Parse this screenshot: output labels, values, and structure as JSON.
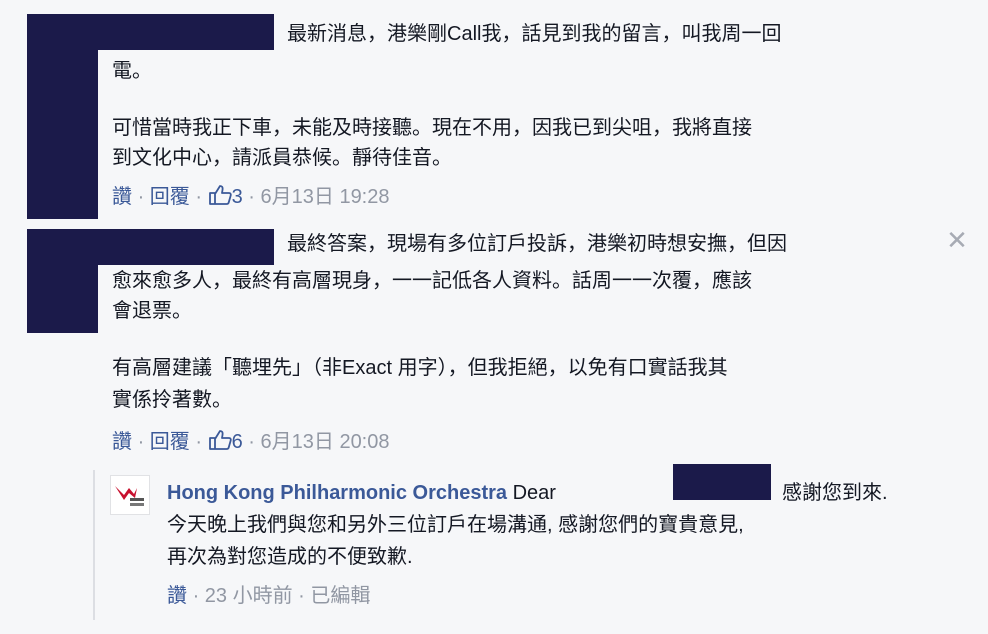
{
  "comments": [
    {
      "paragraphs": [
        "最新消息，港樂剛Call我，話見到我的留言，叫我周一回電。",
        "可惜當時我正下車，未能及時接聽。現在不用，因我已到尖咀，我將直接到文化中心，請派員恭候。靜待佳音。"
      ],
      "line1a": "最新消息，港樂剛Call我，話見到我的留言，叫我周一回",
      "line1b": "電。",
      "line2a": "可惜當時我正下車，未能及時接聽。現在不用，因我已到尖咀，我將直接",
      "line2b": "到文化中心，請派員恭候。靜待佳音。",
      "like_label": "讚",
      "sep": "·",
      "reply_label": "回覆",
      "like_count": "3",
      "timestamp": "6月13日 19:28"
    },
    {
      "line1a": "最終答案，現場有多位訂戶投訴，港樂初時想安撫，但因",
      "line1b": "愈來愈多人，最終有高層現身，一一記低各人資料。話周一一次覆，應該",
      "line1c": "會退票。",
      "line2a": "有高層建議「聽埋先」（非Exact 用字），但我拒絕，以免有口實話我其",
      "line2b": "實係拎著數。",
      "like_label": "讚",
      "sep": "·",
      "reply_label": "回覆",
      "like_count": "6",
      "timestamp": "6月13日 20:08",
      "close_icon": "✕"
    }
  ],
  "reply": {
    "avatar_text": "港樂 HKPhil",
    "author": "Hong Kong Philharmonic Orchestra",
    "dear": "Dear",
    "line1_rest": "感謝您到來.",
    "line2": "今天晚上我們與您和另外三位訂戶在場溝通, 感謝您們的寶貴意見,",
    "line3": "再次為對您造成的不便致歉.",
    "like_label": "讚",
    "sep": "·",
    "time": "23 小時前",
    "edited": "已編輯"
  },
  "colors": {
    "link": "#3b5998",
    "meta": "#9197a3",
    "redaction": "#1b1a4a",
    "background": "#f6f7f9"
  }
}
